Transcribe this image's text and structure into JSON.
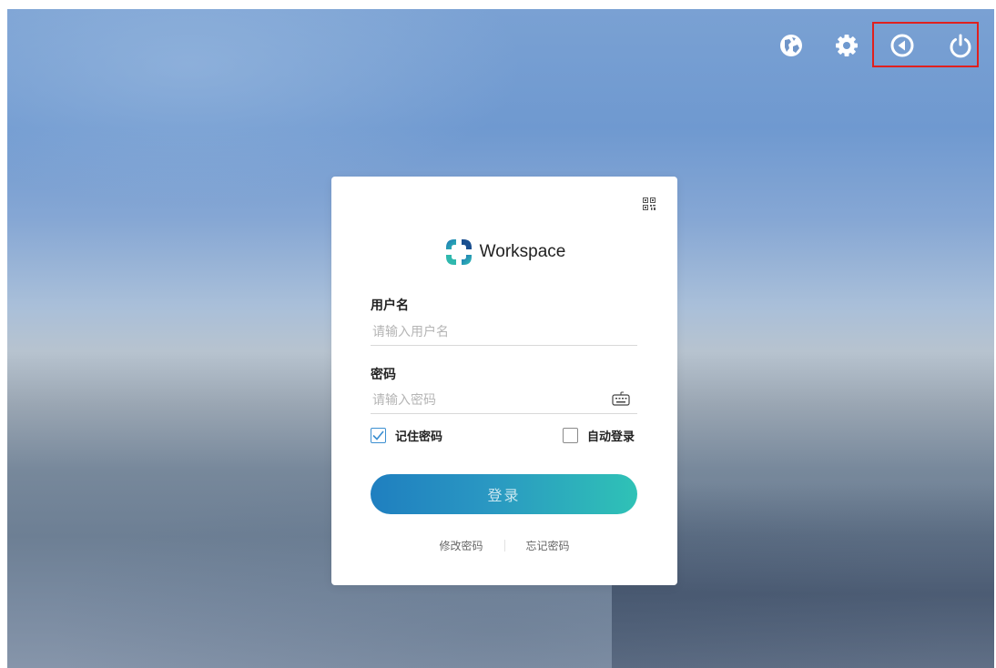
{
  "topbar": {
    "icons": [
      "globe-icon",
      "gear-icon",
      "back-icon",
      "power-icon"
    ]
  },
  "login": {
    "brand": "Workspace",
    "username_label": "用户名",
    "username_placeholder": "请输入用户名",
    "username_value": "",
    "password_label": "密码",
    "password_placeholder": "请输入密码",
    "password_value": "",
    "remember_label": "记住密码",
    "remember_checked": true,
    "autologin_label": "自动登录",
    "autologin_checked": false,
    "login_button": "登录",
    "change_password_link": "修改密码",
    "forgot_password_link": "忘记密码"
  },
  "colors": {
    "button_start": "#1f7fc0",
    "button_end": "#2fc2b6",
    "highlight": "#e0201e",
    "check": "#3b8fd1"
  }
}
